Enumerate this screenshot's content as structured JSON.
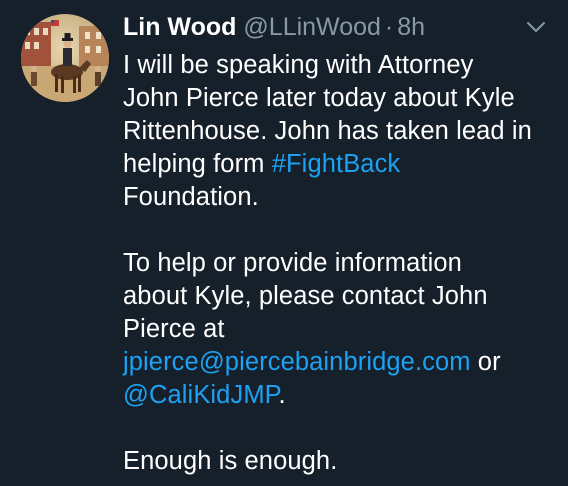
{
  "tweet": {
    "author": {
      "display_name": "Lin Wood",
      "handle": "@LLinWood",
      "separator": "·",
      "time": "8h",
      "avatar": "avatar-painting-horse-rider"
    },
    "menu_icon": "chevron-down-icon",
    "paragraph1": {
      "line1": "I will be speaking with Attorney",
      "line2": "John Pierce later today about Kyle",
      "line3": "Rittenhouse. John has taken lead in",
      "line4_prefix": "helping form ",
      "hashtag": "#FightBack",
      "line5": "Foundation."
    },
    "paragraph2": {
      "line1": "To help or provide information",
      "line2": "about Kyle, please contact John",
      "line3": "Pierce at",
      "email": "jpierce@piercebainbridge.com",
      "or_text": " or",
      "mention": "@CaliKidJMP",
      "period": "."
    },
    "paragraph3": {
      "line1": "Enough is enough."
    }
  },
  "colors": {
    "background": "#15202b",
    "text": "#ffffff",
    "secondary": "#8899a6",
    "link": "#1da1f2"
  }
}
